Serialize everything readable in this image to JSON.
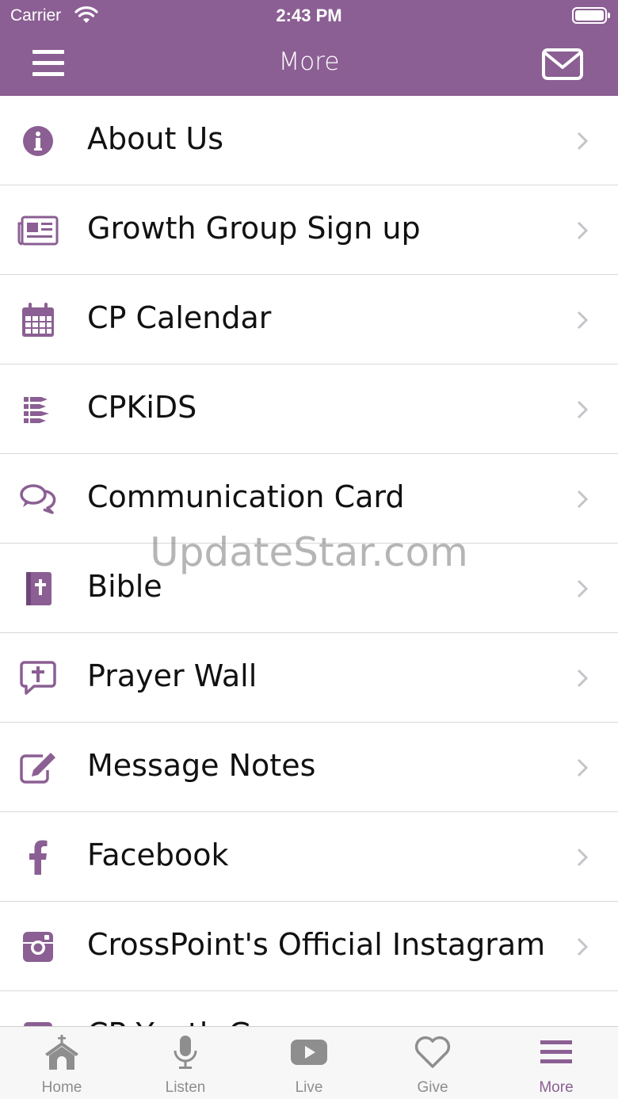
{
  "status_bar": {
    "carrier": "Carrier",
    "time": "2:43 PM"
  },
  "nav": {
    "title": "More",
    "menu_icon": "hamburger-menu-icon",
    "mail_icon": "envelope-icon"
  },
  "theme": {
    "accent": "#8b5f93",
    "tab_inactive": "#8e8e8e",
    "divider": "#d9d9d9"
  },
  "menu_items": [
    {
      "label": "About Us",
      "icon": "info-icon"
    },
    {
      "label": "Growth Group Sign up",
      "icon": "newspaper-icon"
    },
    {
      "label": "CP Calendar",
      "icon": "calendar-icon"
    },
    {
      "label": "CPKiDS",
      "icon": "crayons-icon"
    },
    {
      "label": "Communication Card",
      "icon": "chat-bubbles-icon"
    },
    {
      "label": "Bible",
      "icon": "bible-icon"
    },
    {
      "label": "Prayer Wall",
      "icon": "prayer-bubble-icon"
    },
    {
      "label": "Message Notes",
      "icon": "edit-note-icon"
    },
    {
      "label": "Facebook",
      "icon": "facebook-icon"
    },
    {
      "label": "CrossPoint's Official Instagram",
      "icon": "instagram-icon"
    },
    {
      "label": "CP Youth Group",
      "icon": "partial-icon"
    }
  ],
  "watermark": "UpdateStar.com",
  "tabs": [
    {
      "label": "Home",
      "icon": "church-icon",
      "active": false
    },
    {
      "label": "Listen",
      "icon": "microphone-icon",
      "active": false
    },
    {
      "label": "Live",
      "icon": "video-play-icon",
      "active": false
    },
    {
      "label": "Give",
      "icon": "heart-icon",
      "active": false
    },
    {
      "label": "More",
      "icon": "menu-lines-icon",
      "active": true
    }
  ]
}
